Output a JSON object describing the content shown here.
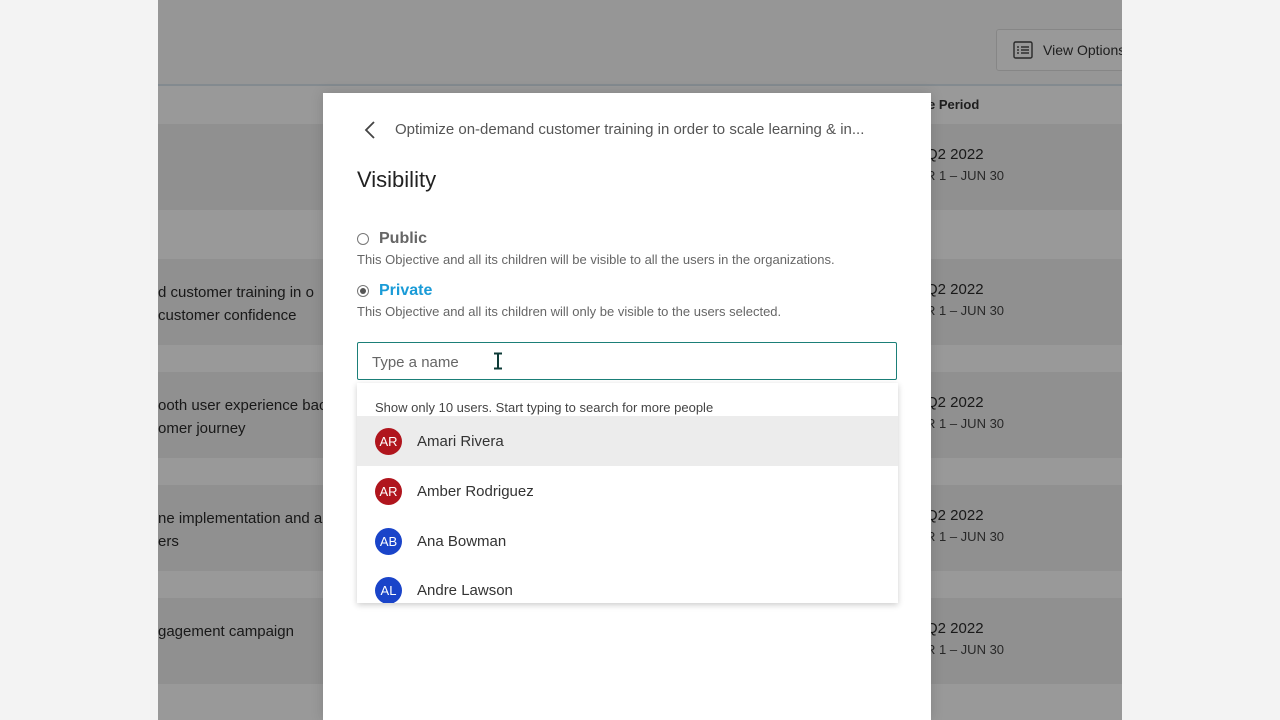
{
  "toolbar": {
    "view_options_label": "View Options"
  },
  "table": {
    "period_header": "e Period",
    "rows": [
      {
        "title_line1": "",
        "title_line2": "",
        "quarter": "Q2 2022",
        "dates": "R 1 – JUN 30"
      },
      {
        "title_line1": "d customer training in o",
        "title_line2": "customer confidence",
        "quarter": "Q2 2022",
        "dates": "R 1 – JUN 30"
      },
      {
        "title_line1": "ooth user experience bac",
        "title_line2": "omer journey",
        "quarter": "Q2 2022",
        "dates": "R 1 – JUN 30"
      },
      {
        "title_line1": "ne implementation and a",
        "title_line2": "ers",
        "quarter": "Q2 2022",
        "dates": "R 1 – JUN 30"
      },
      {
        "title_line1": "gagement campaign",
        "title_line2": "",
        "quarter": "Q2 2022",
        "dates": "R 1 – JUN 30"
      }
    ]
  },
  "modal": {
    "breadcrumb": "Optimize on-demand customer training in order to scale learning & in...",
    "heading": "Visibility",
    "options": [
      {
        "label": "Public",
        "description": "This Objective and all its children will be visible to all the users in the organizations.",
        "selected": false
      },
      {
        "label": "Private",
        "description": "This Objective and all its children will only be visible to the users selected.",
        "selected": true
      }
    ],
    "search": {
      "placeholder": "Type a name",
      "value": ""
    },
    "dropdown": {
      "hint": "Show only 10 users. Start typing to search for more people",
      "people": [
        {
          "initials": "AR",
          "name": "Amari Rivera",
          "color": "#b0151d"
        },
        {
          "initials": "AR",
          "name": "Amber Rodriguez",
          "color": "#b0151d"
        },
        {
          "initials": "AB",
          "name": "Ana Bowman",
          "color": "#1a44c9"
        },
        {
          "initials": "AL",
          "name": "Andre Lawson",
          "color": "#1a44c9"
        }
      ]
    }
  },
  "colors": {
    "accent": "#1a9bd7",
    "input_border": "#1b7f78"
  }
}
